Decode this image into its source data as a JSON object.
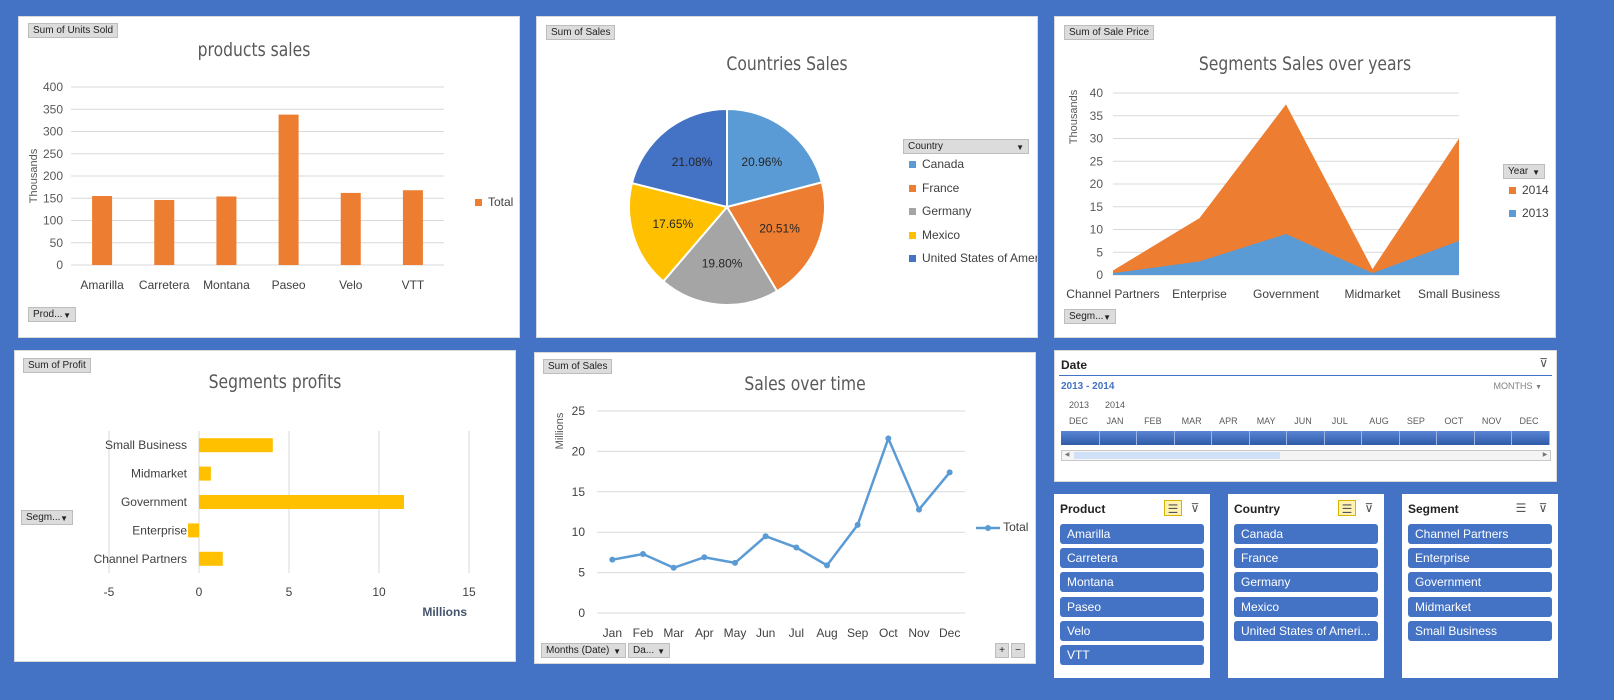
{
  "colors": {
    "background": "#4472c4",
    "orange": "#ed7d31",
    "blue": "#5b9bd5",
    "gray": "#a5a5a5",
    "yellow": "#ffc000",
    "darkblue": "#4472c4"
  },
  "products_chart": {
    "field_button": "Sum of Units Sold",
    "filter_button": "Prod...",
    "legend": "Total",
    "chart_data": {
      "type": "bar",
      "title": "products sales",
      "ylabel": "Thousands",
      "categories": [
        "Amarilla",
        "Carretera",
        "Montana",
        "Paseo",
        "Velo",
        "VTT"
      ],
      "values": [
        155,
        146,
        154,
        338,
        162,
        168
      ],
      "ylim": [
        0,
        400
      ],
      "yticks": [
        "400",
        "350",
        "300",
        "250",
        "200",
        "150",
        "100",
        "50",
        "0"
      ],
      "series": [
        {
          "name": "Total",
          "values": [
            155,
            146,
            154,
            338,
            162,
            168
          ]
        }
      ]
    }
  },
  "countries_chart": {
    "field_button": "Sum of  Sales",
    "legend_header": "Country",
    "chart_data": {
      "type": "pie",
      "title": "Countries Sales",
      "categories": [
        "Canada",
        "France",
        "Germany",
        "Mexico",
        "United States of America"
      ],
      "values": [
        20.96,
        20.51,
        19.8,
        17.65,
        21.08
      ],
      "labels": [
        "20.96%",
        "20.51%",
        "19.80%",
        "17.65%",
        "21.08%"
      ]
    }
  },
  "segments_years_chart": {
    "field_button": "Sum of Sale Price",
    "filter_button": "Segm...",
    "legend_header": "Year",
    "chart_data": {
      "type": "area",
      "title": "Segments Sales over years",
      "ylabel": "Thousands",
      "categories": [
        "Channel Partners",
        "Enterprise",
        "Government",
        "Midmarket",
        "Small Business"
      ],
      "ylim": [
        0,
        40
      ],
      "yticks": [
        "40",
        "35",
        "30",
        "25",
        "20",
        "15",
        "10",
        "5",
        "0"
      ],
      "series": [
        {
          "name": "2014",
          "values": [
            0.6,
            9.5,
            28.5,
            0.9,
            22.5
          ]
        },
        {
          "name": "2013",
          "values": [
            0.4,
            3.0,
            9.0,
            0.4,
            7.5
          ]
        }
      ]
    }
  },
  "profits_chart": {
    "field_button": "Sum of Profit",
    "filter_button": "Segm...",
    "chart_data": {
      "type": "bar",
      "orientation": "horizontal",
      "title": "Segments profits",
      "xlabel": "Millions",
      "categories": [
        "Small Business",
        "Midmarket",
        "Government",
        "Enterprise",
        "Channel Partners"
      ],
      "values": [
        4.1,
        0.66,
        11.39,
        -0.61,
        1.32
      ],
      "xlim": [
        -5,
        15
      ],
      "xticks": [
        "-5",
        "0",
        "5",
        "10",
        "15"
      ]
    }
  },
  "time_chart": {
    "field_button": "Sum of  Sales",
    "filter_button_1": "Months (Date)",
    "filter_button_2": "Da...",
    "legend": "Total",
    "zoom_in": "+",
    "zoom_out": "−",
    "chart_data": {
      "type": "line",
      "title": "Sales over time",
      "ylabel": "Millions",
      "x": [
        "Jan",
        "Feb",
        "Mar",
        "Apr",
        "May",
        "Jun",
        "Jul",
        "Aug",
        "Sep",
        "Oct",
        "Nov",
        "Dec"
      ],
      "ylim": [
        0,
        25
      ],
      "yticks": [
        "25",
        "20",
        "15",
        "10",
        "5",
        "0"
      ],
      "series": [
        {
          "name": "Total",
          "values": [
            6.6,
            7.3,
            5.6,
            6.9,
            6.2,
            9.5,
            8.1,
            5.9,
            10.9,
            21.6,
            12.8,
            17.4
          ]
        }
      ]
    }
  },
  "timeline": {
    "header": "Date",
    "range": "2013 - 2014",
    "level": "MONTHS",
    "years": [
      "2013",
      "2014"
    ],
    "months": [
      "DEC",
      "JAN",
      "FEB",
      "MAR",
      "APR",
      "MAY",
      "JUN",
      "JUL",
      "AUG",
      "SEP",
      "OCT",
      "NOV",
      "DEC"
    ]
  },
  "slicers": {
    "product": {
      "header": "Product",
      "items": [
        "Amarilla",
        "Carretera",
        "Montana",
        "Paseo",
        "Velo",
        "VTT"
      ]
    },
    "country": {
      "header": "Country",
      "items": [
        "Canada",
        "France",
        "Germany",
        "Mexico",
        "United States of Ameri..."
      ]
    },
    "segment": {
      "header": "Segment",
      "items": [
        "Channel Partners",
        "Enterprise",
        "Government",
        "Midmarket",
        "Small Business"
      ]
    }
  }
}
